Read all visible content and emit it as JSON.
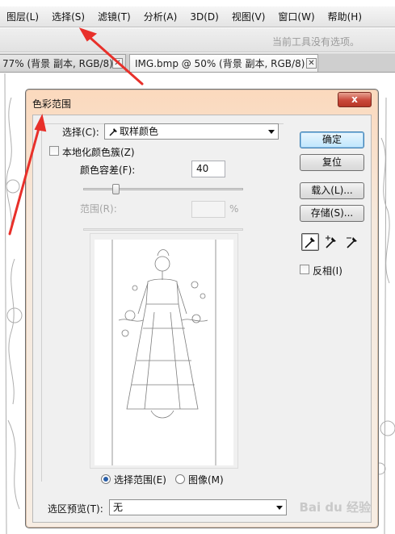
{
  "menu": {
    "items": [
      "图层(L)",
      "选择(S)",
      "滤镜(T)",
      "分析(A)",
      "3D(D)",
      "视图(V)",
      "窗口(W)",
      "帮助(H)"
    ]
  },
  "options_bar": {
    "hint": "当前工具没有选项。"
  },
  "doc_tabs": [
    {
      "label": "77% (背景 副本, RGB/8) *"
    },
    {
      "label": "IMG.bmp @ 50% (背景 副本, RGB/8) *"
    }
  ],
  "tab_close_glyph": "✕",
  "dialog": {
    "title": "色彩范围",
    "close_glyph": "x",
    "select_label": "选择(C):",
    "select_value": "取样颜色",
    "localized_label": "本地化颜色簇(Z)",
    "localized_checked": false,
    "fuzziness_label": "颜色容差(F):",
    "fuzziness_value": "40",
    "fuzziness_slider_fraction": 0.2,
    "range_label": "范围(R):",
    "range_value": "",
    "range_unit": "%",
    "preview_mode": {
      "selection_label": "选择范围(E)",
      "image_label": "图像(M)",
      "selected": "selection"
    },
    "selection_preview_label": "选区预览(T):",
    "selection_preview_value": "无",
    "buttons": {
      "ok": "确定",
      "reset": "复位",
      "load": "载入(L)...",
      "save": "存储(S)..."
    },
    "eyedropper_tools": [
      "eyedropper-icon",
      "eyedropper-plus-icon",
      "eyedropper-minus-icon"
    ],
    "invert_label": "反相(I)",
    "invert_checked": false
  },
  "watermark": "Bai du 经验",
  "colors": {
    "dialog_title_bg": "#fbd9bd",
    "close_button": "#c9483a",
    "annotation_arrow": "#e8302a",
    "default_button": "#3c7fb1"
  }
}
